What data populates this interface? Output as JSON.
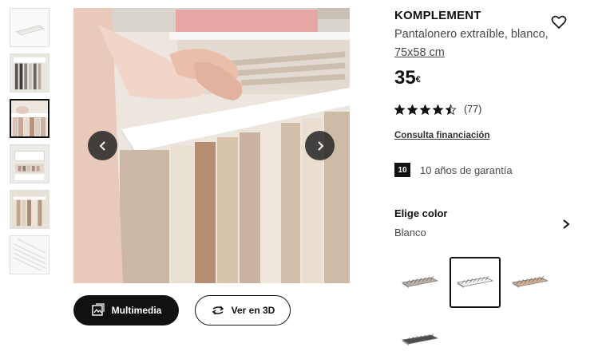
{
  "product": {
    "name": "KOMPLEMENT",
    "description": "Pantalonero extraíble, blanco,",
    "size": "75x58 cm",
    "price_value": "35",
    "price_currency": "€",
    "rating_count": "(77)",
    "rating_value": 4.5,
    "rating_max": 5,
    "financing_link": "Consulta financiación",
    "guarantee_badge": "10",
    "guarantee_text": "10 años de garantía"
  },
  "color": {
    "title": "Elige color",
    "selected": "Blanco",
    "swatches": [
      {
        "name": "beige-stone",
        "color": "#b9aea3",
        "selected": false
      },
      {
        "name": "white",
        "color": "#f2f2f2",
        "selected": true
      },
      {
        "name": "oak",
        "color": "#c9ad8d",
        "selected": false
      },
      {
        "name": "dark-grey",
        "color": "#4c4c4c",
        "selected": false
      }
    ]
  },
  "buttons": {
    "media_label": "Multimedia",
    "view3d_label": "Ver en 3D"
  },
  "gallery": {
    "thumbnail_count": 6,
    "selected_index": 2
  },
  "icons": {
    "favorite": "heart-icon",
    "prev": "chevron-left-icon",
    "next": "chevron-right-icon",
    "media": "gallery-icon",
    "view3d": "rotate-3d-icon",
    "color_chevron": "chevron-right-icon"
  }
}
